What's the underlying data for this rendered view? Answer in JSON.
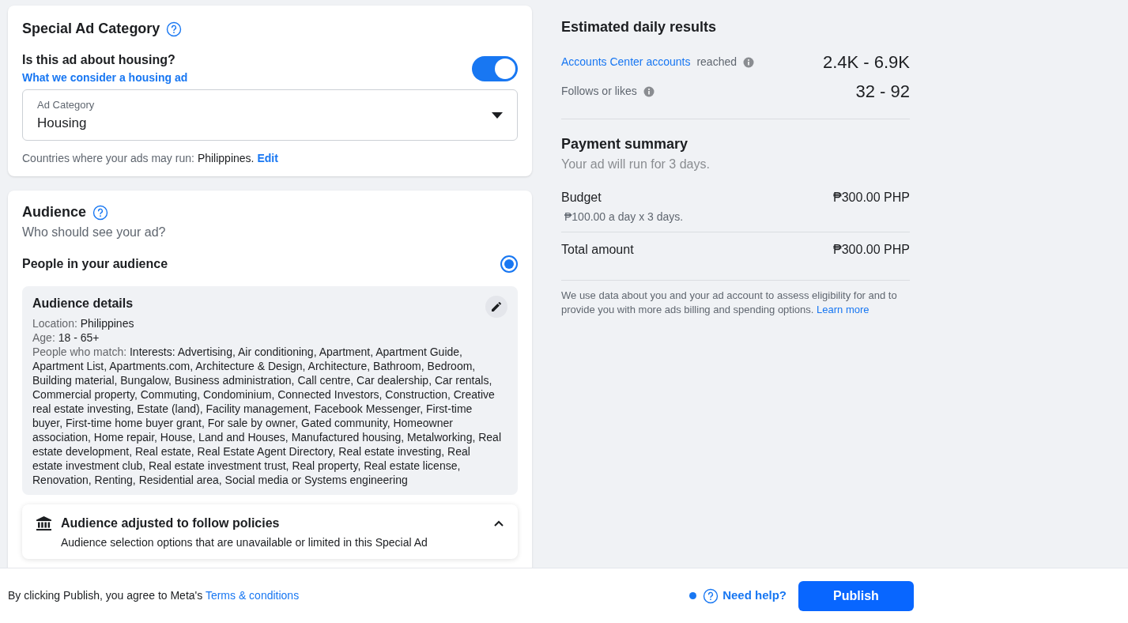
{
  "special_ad_category": {
    "title": "Special Ad Category",
    "question": "Is this ad about housing?",
    "link": "What we consider a housing ad",
    "toggle_on": true,
    "field": {
      "label": "Ad Category",
      "value": "Housing"
    },
    "countries_label": "Countries where your ads may run:",
    "countries_value": "Philippines.",
    "edit_link": "Edit"
  },
  "audience": {
    "title": "Audience",
    "subtitle": "Who should see your ad?",
    "option": {
      "label": "People in your audience",
      "selected": true
    },
    "details": {
      "title": "Audience details",
      "rows": [
        {
          "label": "Location:",
          "value": "Philippines"
        },
        {
          "label": "Age:",
          "value": "18 - 65+"
        },
        {
          "label": "People who match:",
          "value": "Interests: Advertising, Air conditioning, Apartment, Apartment Guide, Apartment List, Apartments.com, Architecture & Design, Architecture, Bathroom, Bedroom, Building material, Bungalow, Business administration, Call centre, Car dealership, Car rentals, Commercial property, Commuting, Condominium, Connected Investors, Construction, Creative real estate investing, Estate (land), Facility management, Facebook Messenger, First-time buyer, First-time home buyer grant, For sale by owner, Gated community, Homeowner association, Home repair, House, Land and Houses, Manufactured housing, Metalworking, Real estate development, Real estate, Real Estate Agent Directory, Real estate investing, Real estate investment club, Real estate investment trust, Real property, Real estate license, Renovation, Renting, Residential area, Social media or Systems engineering"
        }
      ]
    },
    "policy": {
      "title": "Audience adjusted to follow policies",
      "text": "Audience selection options that are unavailable or limited in this Special Ad",
      "expanded": true
    }
  },
  "estimated_daily_results": {
    "title": "Estimated daily results",
    "rows": [
      {
        "link": "Accounts Center accounts",
        "label": "reached",
        "value": "2.4K - 6.9K"
      },
      {
        "label": "Follows or likes",
        "value": "32 - 92"
      }
    ]
  },
  "payment_summary": {
    "title": "Payment summary",
    "subtitle": "Your ad will run for 3 days.",
    "budget": {
      "label": "Budget",
      "value": "₱300.00 PHP",
      "detail": "₱100.00 a day x 3 days."
    },
    "total": {
      "label": "Total amount",
      "value": "₱300.00 PHP"
    },
    "notice": "We use data about you and your ad account to assess eligibility for and to provide you with more ads billing and spending options.",
    "notice_link": "Learn more"
  },
  "footer": {
    "agreement": "By clicking Publish, you agree to Meta's",
    "terms_link": "Terms & conditions",
    "help": "Need help?",
    "publish": "Publish"
  }
}
